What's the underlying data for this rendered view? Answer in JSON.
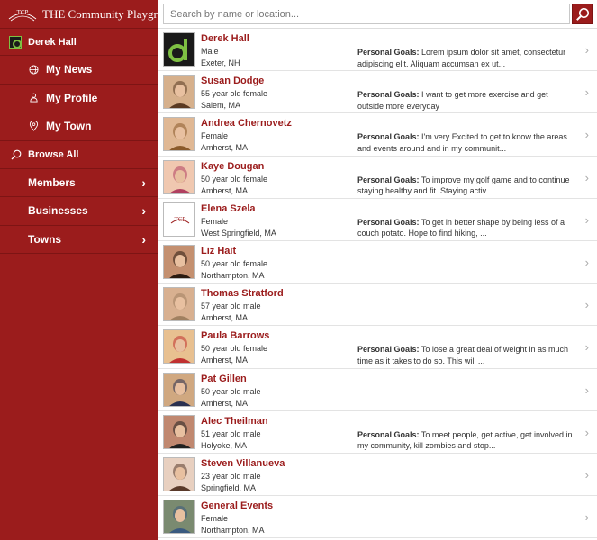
{
  "brand": {
    "logo_text": "TCP",
    "title": "THE Community Playground"
  },
  "user": {
    "name": "Derek Hall"
  },
  "nav_sub": [
    {
      "label": "My News",
      "icon": "globe-icon"
    },
    {
      "label": "My Profile",
      "icon": "person-icon"
    },
    {
      "label": "My Town",
      "icon": "map-pin-icon"
    }
  ],
  "browse": {
    "label": "Browse All",
    "icon": "search-icon"
  },
  "nav_main": [
    {
      "label": "Members"
    },
    {
      "label": "Businesses"
    },
    {
      "label": "Towns"
    }
  ],
  "search": {
    "placeholder": "Search by name or location..."
  },
  "goals_label": "Personal Goals:",
  "members": [
    {
      "name": "Derek Hall",
      "line1": "Male",
      "line2": "Exeter, NH",
      "goals": "Lorem ipsum dolor sit amet, consectetur adipiscing elit. Aliquam accumsan ex ut...",
      "thumb": "logo-d"
    },
    {
      "name": "Susan Dodge",
      "line1": "55 year old female",
      "line2": "Salem, MA",
      "goals": "I want to get more exercise and get outside more everyday",
      "thumb": "photo"
    },
    {
      "name": "Andrea Chernovetz",
      "line1": "Female",
      "line2": "Amherst, MA",
      "goals": "I'm very Excited to get to know the areas and events around and in my communit...",
      "thumb": "photo"
    },
    {
      "name": "Kaye Dougan",
      "line1": "50 year old female",
      "line2": "Amherst, MA",
      "goals": "To improve my golf game and to continue staying healthy and fit. Staying activ...",
      "thumb": "photo"
    },
    {
      "name": "Elena Szela",
      "line1": "Female",
      "line2": "West Springfield, MA",
      "goals": "To get in better shape by being less of a couch potato. Hope to find hiking, ...",
      "thumb": "tcp"
    },
    {
      "name": "Liz Hait",
      "line1": "50 year old female",
      "line2": "Northampton, MA",
      "goals": "",
      "thumb": "photo"
    },
    {
      "name": "Thomas Stratford",
      "line1": "57 year old male",
      "line2": "Amherst, MA",
      "goals": "",
      "thumb": "photo"
    },
    {
      "name": "Paula Barrows",
      "line1": "50 year old female",
      "line2": "Amherst, MA",
      "goals": "To lose a great deal of weight in as much time as it takes to do so. This will ...",
      "thumb": "photo"
    },
    {
      "name": "Pat Gillen",
      "line1": "50 year old male",
      "line2": "Amherst, MA",
      "goals": "",
      "thumb": "photo"
    },
    {
      "name": "Alec Theilman",
      "line1": "51 year old male",
      "line2": "Holyoke, MA",
      "goals": "To meet people, get active, get involved in my community, kill zombies and stop...",
      "thumb": "photo"
    },
    {
      "name": "Steven Villanueva",
      "line1": "23 year old male",
      "line2": "Springfield, MA",
      "goals": "",
      "thumb": "photo"
    },
    {
      "name": "General Events",
      "line1": "Female",
      "line2": "Northampton, MA",
      "goals": "",
      "thumb": "photo"
    }
  ],
  "colors": {
    "accent": "#9b1c1c",
    "accent_dark": "#7d1414",
    "logo_green": "#7ec043"
  }
}
